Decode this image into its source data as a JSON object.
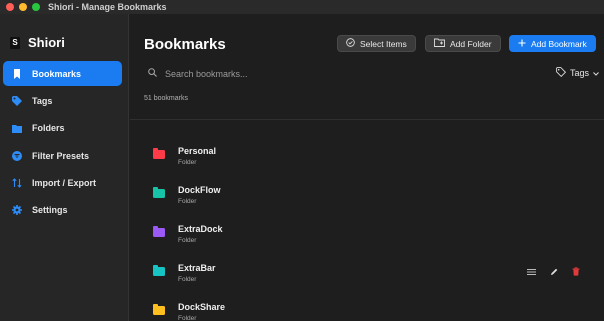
{
  "window": {
    "title": "Shiori - Manage Bookmarks"
  },
  "sidebar": {
    "brand": "Shiori",
    "brand_logo": "S",
    "items": [
      {
        "label": "Bookmarks",
        "icon": "bookmark-icon",
        "active": true
      },
      {
        "label": "Tags",
        "icon": "tag-icon"
      },
      {
        "label": "Folders",
        "icon": "folder-icon"
      },
      {
        "label": "Filter Presets",
        "icon": "filter-icon"
      },
      {
        "label": "Import / Export",
        "icon": "import-export-icon"
      },
      {
        "label": "Settings",
        "icon": "gear-icon"
      }
    ]
  },
  "header": {
    "title": "Bookmarks",
    "select_label": "Select Items",
    "add_folder_label": "Add Folder",
    "add_bookmark_label": "Add Bookmark"
  },
  "search": {
    "placeholder": "Search bookmarks..."
  },
  "tags_filter": {
    "label": "Tags"
  },
  "count_label": "51 bookmarks",
  "items": [
    {
      "name": "Personal",
      "type": "Folder",
      "color": "#ff3b47"
    },
    {
      "name": "DockFlow",
      "type": "Folder",
      "color": "#17c4a7"
    },
    {
      "name": "ExtraDock",
      "type": "Folder",
      "color": "#9b59f5"
    },
    {
      "name": "ExtraBar",
      "type": "Folder",
      "color": "#17c4c4"
    },
    {
      "name": "DockShare",
      "type": "Folder",
      "color": "#ffbf1f"
    }
  ],
  "colors": {
    "accent": "#1a7cf0",
    "delete": "#e03a3a"
  }
}
